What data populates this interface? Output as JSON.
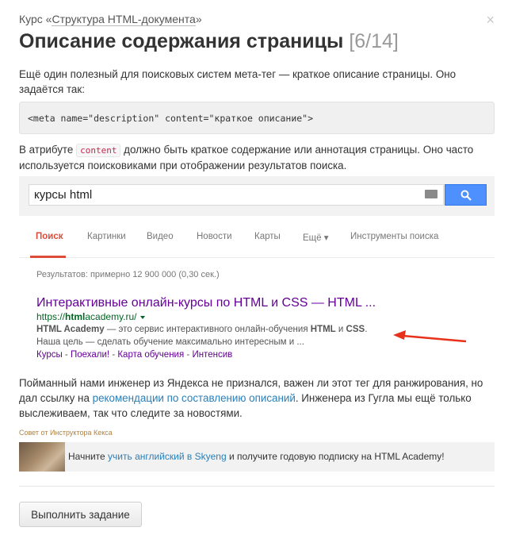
{
  "header": {
    "course_prefix": "Курс «",
    "course_link": "Структура HTML-документа",
    "course_suffix": "»",
    "close": "×",
    "title": "Описание содержания страницы",
    "counter": "[6/14]"
  },
  "intro": "Ещё один полезный для поисковых систем мета-тег — краткое описание страницы. Оно задаётся так:",
  "code_sample": "<meta name=\"description\" content=\"краткое описание\">",
  "attr_text": {
    "before": "В атрибуте ",
    "code": "content",
    "after": " должно быть краткое содержание или аннотация страницы. Оно часто используется поисковиками при отображении результатов поиска."
  },
  "google": {
    "query": "курсы html",
    "tabs": [
      {
        "label": "Поиск",
        "active": true
      },
      {
        "label": "Картинки"
      },
      {
        "label": "Видео"
      },
      {
        "label": "Новости"
      },
      {
        "label": "Карты"
      },
      {
        "label": "Ещё ▾"
      },
      {
        "label": "Инструменты поиска"
      }
    ],
    "stats": "Результатов: примерно 12 900 000 (0,30 сек.)",
    "result": {
      "title": "Интерактивные онлайн-курсы по HTML и CSS — HTML ...",
      "url_prefix": "https://",
      "url_bold": "html",
      "url_suffix": "academy.ru/",
      "snippet_b1": "HTML Academy",
      "snippet_1": " — это сервис интерактивного онлайн-обучения ",
      "snippet_b2": "HTML",
      "snippet_2": " и ",
      "snippet_b3": "CSS",
      "snippet_3": ". Наша цель — сделать обучение максимально интересным и ...",
      "sitelinks": [
        "Курсы",
        "Поехали!",
        "Карта обучения",
        "Интенсив"
      ],
      "sitelink_sep": " - "
    },
    "colors": {
      "accent": "#dd4b39",
      "link": "#660099",
      "url": "#006621",
      "button": "#4d90fe",
      "arrow": "#e8311a"
    }
  },
  "outro": {
    "before": "Пойманный нами инженер из Яндекса не признался, важен ли этот тег для ранжирования, но дал ссылку на ",
    "link": "рекомендации по составлению описаний",
    "after": ". Инженера из Гугла мы ещё только выслеживаем, так что следите за новостями."
  },
  "credit": "Совет от Инструктора Кекса",
  "promo": {
    "before": "Начните ",
    "link": "учить английский в Skyeng",
    "after": " и получите годовую подписку на HTML Academy!"
  },
  "action_button": "Выполнить задание"
}
